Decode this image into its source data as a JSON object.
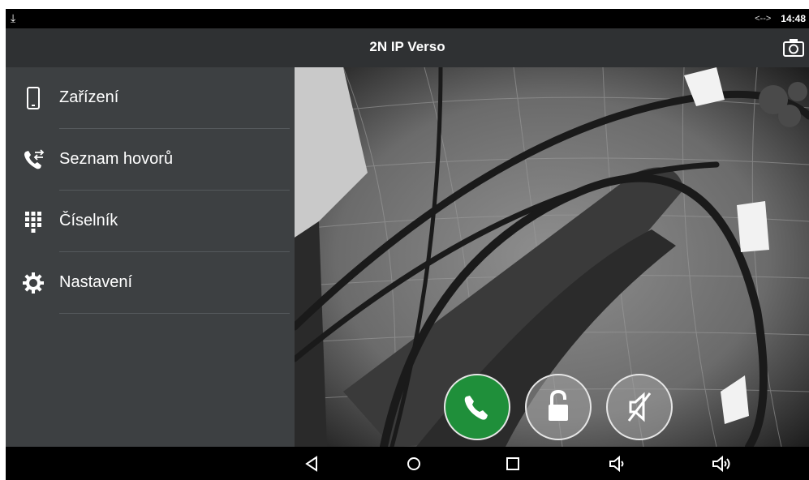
{
  "status_bar": {
    "time": "14:48",
    "link_indicator": "<-->",
    "download_icon": "download-icon"
  },
  "app_bar": {
    "title": "2N IP Verso",
    "snapshot_icon": "camera-icon"
  },
  "sidebar": {
    "items": [
      {
        "label": "Zařízení",
        "icon": "phone-device-icon"
      },
      {
        "label": "Seznam hovorů",
        "icon": "call-log-icon"
      },
      {
        "label": "Číselník",
        "icon": "dialpad-icon"
      },
      {
        "label": "Nastavení",
        "icon": "gear-icon"
      }
    ]
  },
  "actions": {
    "answer_icon": "phone-call-icon",
    "unlock_icon": "lock-icon",
    "mute_icon": "speaker-muted-icon",
    "answer_color": "#1f8f3a"
  },
  "nav_bar": {
    "buttons": [
      "back-icon",
      "home-icon",
      "recents-icon",
      "volume-down-icon",
      "volume-up-icon"
    ]
  }
}
